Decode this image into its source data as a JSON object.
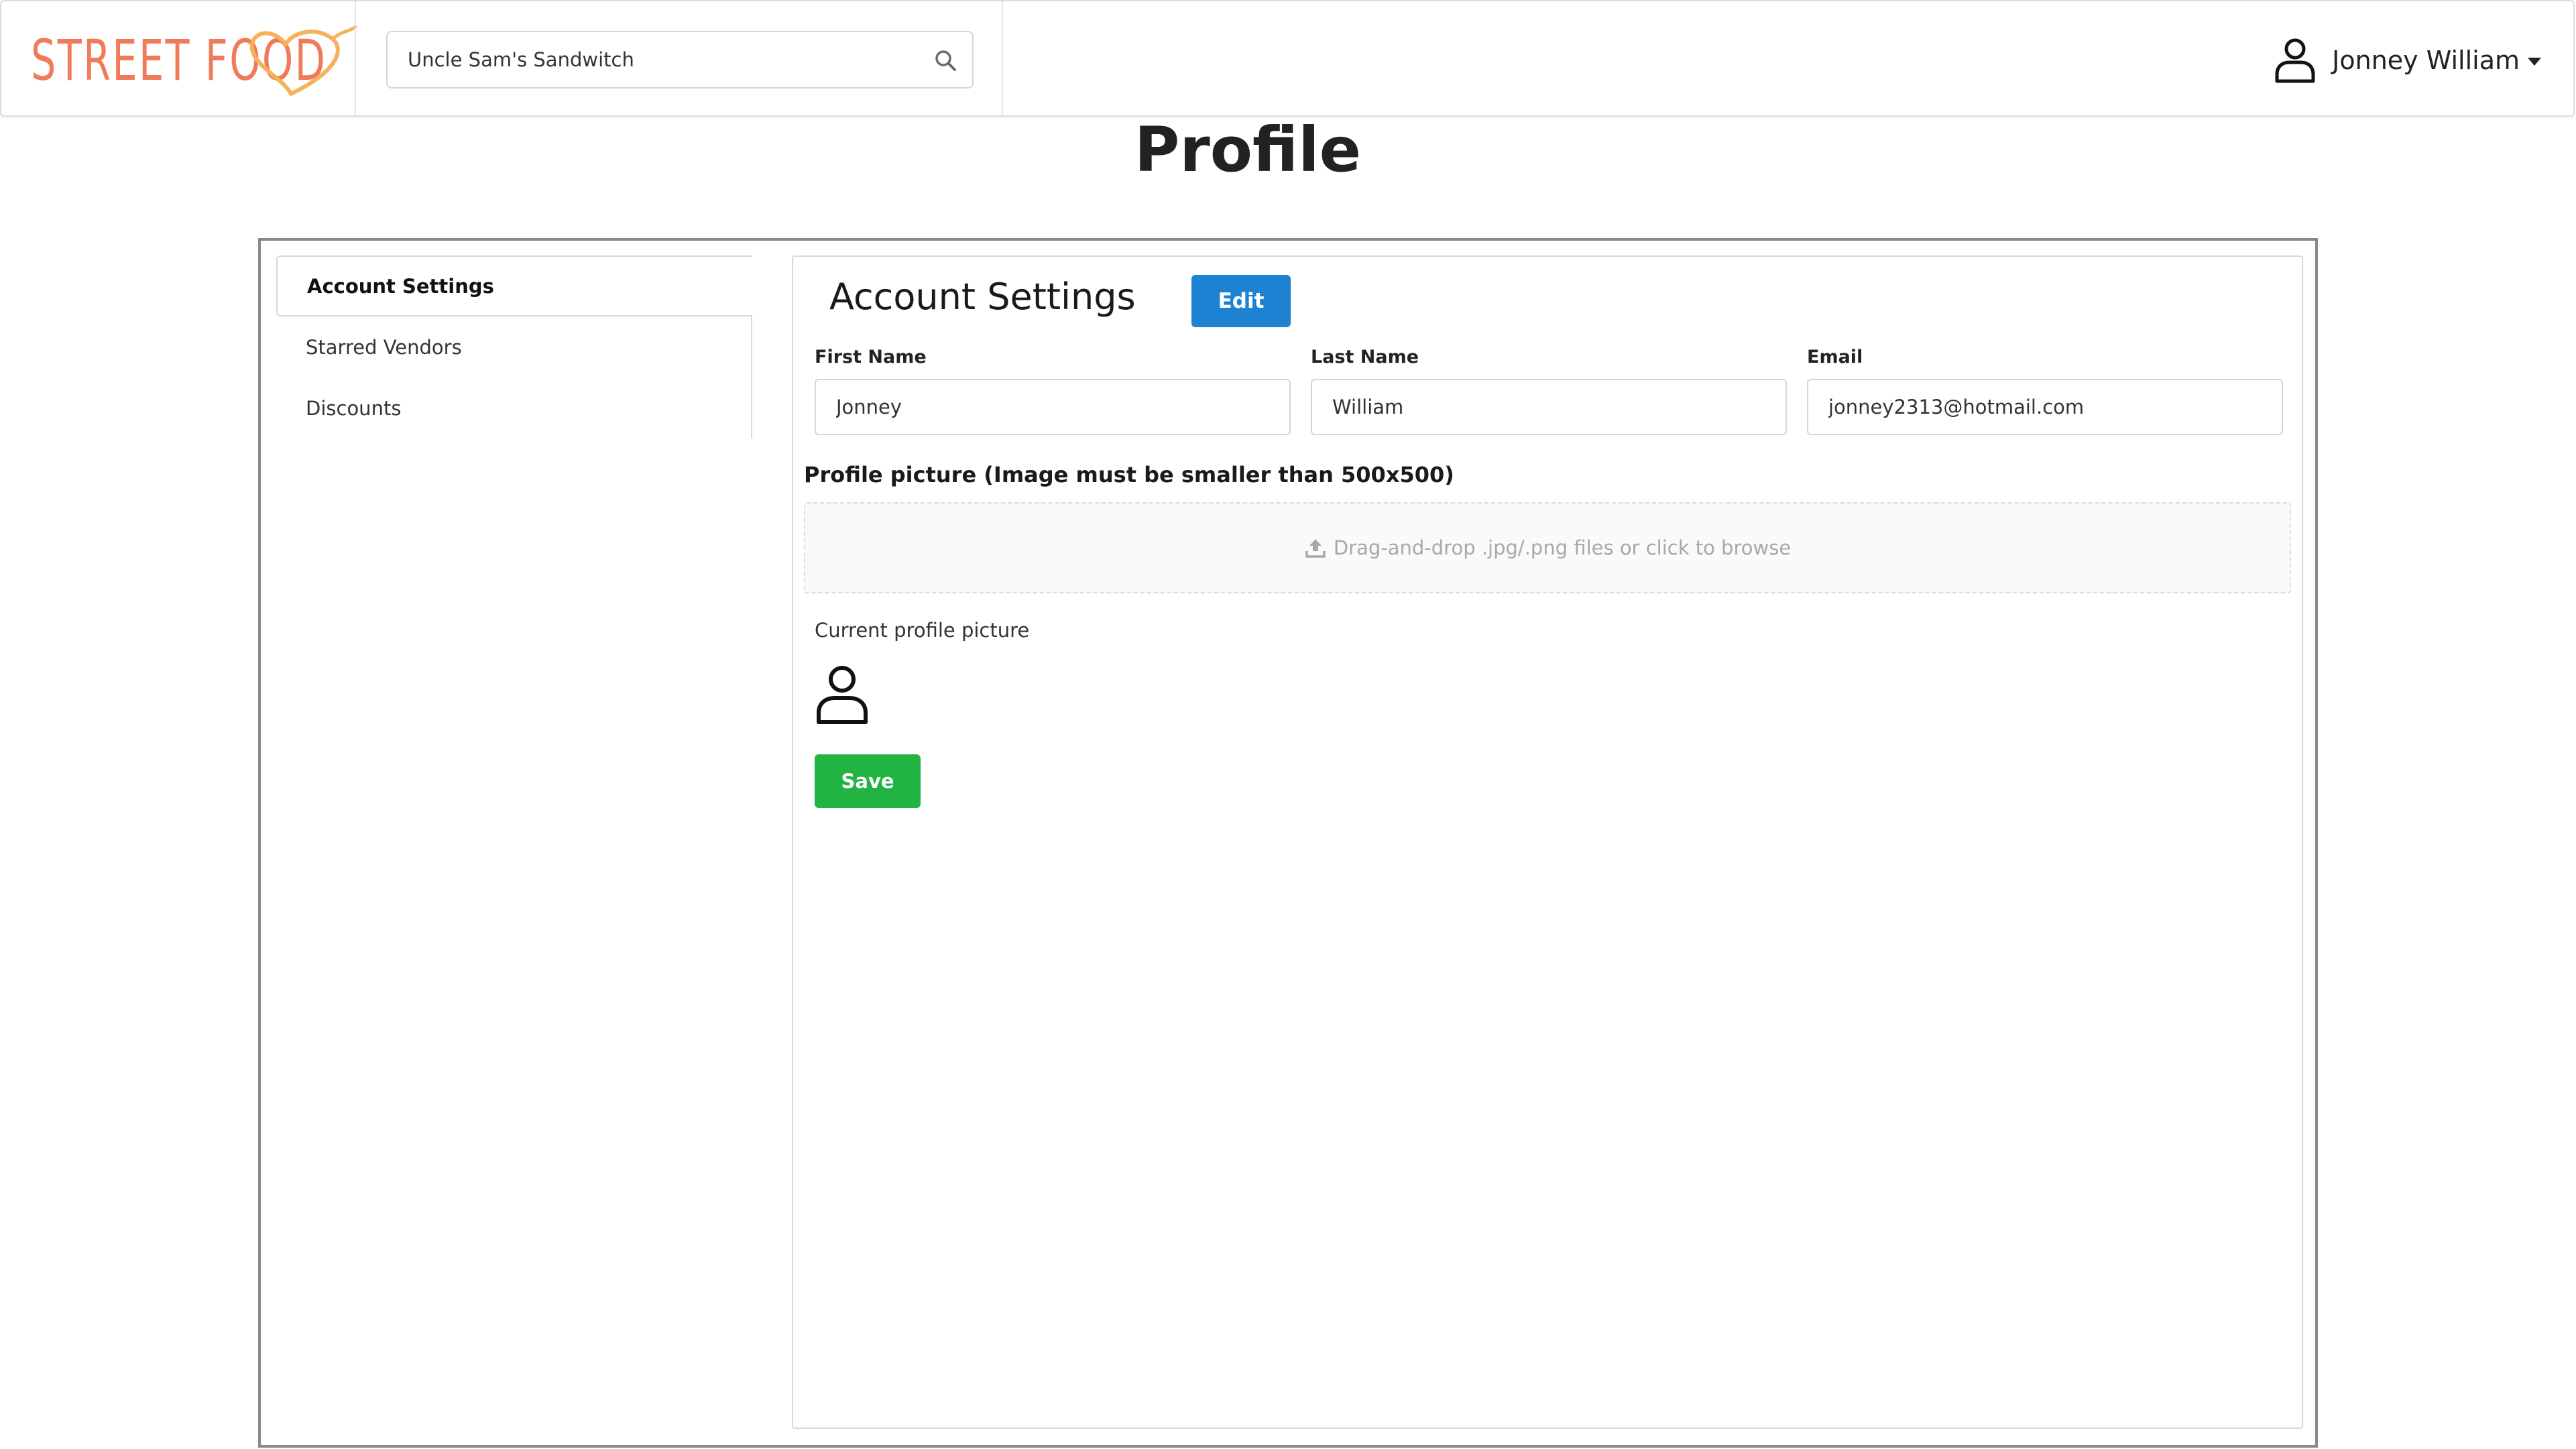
{
  "header": {
    "logo_text": "STREET FOOD",
    "search_value": "Uncle Sam's Sandwitch",
    "user_name": "Jonney William"
  },
  "page": {
    "title": "Profile"
  },
  "sidebar": {
    "items": [
      {
        "label": "Account Settings",
        "active": true
      },
      {
        "label": "Starred Vendors",
        "active": false
      },
      {
        "label": "Discounts",
        "active": false
      }
    ]
  },
  "account": {
    "title": "Account Settings",
    "edit_label": "Edit",
    "first_name_label": "First Name",
    "first_name": "Jonney",
    "last_name_label": "Last Name",
    "last_name": "William",
    "email_label": "Email",
    "email": "jonney2313@hotmail.com",
    "picture_label": "Profile picture (Image must be smaller than 500x500)",
    "dropzone_text": "Drag-and-drop .jpg/.png files or click to browse",
    "current_picture_label": "Current profile picture",
    "save_label": "Save"
  },
  "colors": {
    "brand": "#f07b5a",
    "heart": "#f5b25a",
    "edit_button": "#1e82d2",
    "save_button": "#22b443"
  },
  "icons": [
    "heart-icon",
    "search-icon",
    "user-icon",
    "chevron-down-icon",
    "upload-icon",
    "avatar-icon"
  ]
}
